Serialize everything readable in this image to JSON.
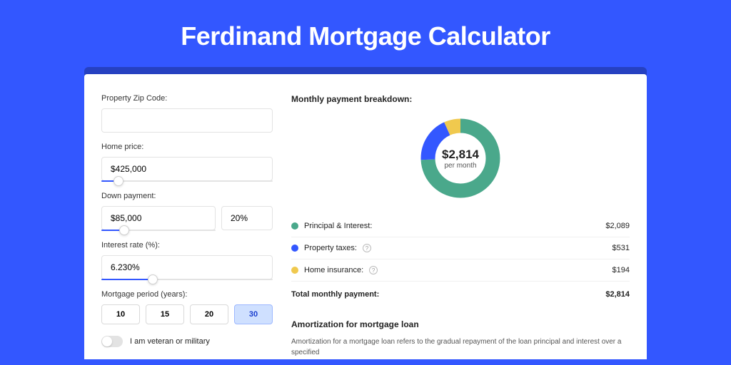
{
  "page": {
    "title": "Ferdinand Mortgage Calculator"
  },
  "form": {
    "zip": {
      "label": "Property Zip Code:",
      "value": ""
    },
    "homePrice": {
      "label": "Home price:",
      "value": "$425,000",
      "sliderPct": 10
    },
    "downPayment": {
      "label": "Down payment:",
      "amount": "$85,000",
      "percent": "20%",
      "sliderPct": 20
    },
    "interestRate": {
      "label": "Interest rate (%):",
      "value": "6.230%",
      "sliderPct": 30
    },
    "period": {
      "label": "Mortgage period (years):",
      "options": [
        "10",
        "15",
        "20",
        "30"
      ],
      "selectedIndex": 3
    },
    "veteran": {
      "label": "I am veteran or military",
      "checked": false
    }
  },
  "breakdown": {
    "title": "Monthly payment breakdown:",
    "centerAmount": "$2,814",
    "centerSub": "per month",
    "items": [
      {
        "label": "Principal & Interest:",
        "value": "$2,089",
        "color": "green",
        "help": false
      },
      {
        "label": "Property taxes:",
        "value": "$531",
        "color": "blue",
        "help": true
      },
      {
        "label": "Home insurance:",
        "value": "$194",
        "color": "yellow",
        "help": true
      }
    ],
    "totalLabel": "Total monthly payment:",
    "totalValue": "$2,814"
  },
  "amortization": {
    "title": "Amortization for mortgage loan",
    "text": "Amortization for a mortgage loan refers to the gradual repayment of the loan principal and interest over a specified"
  },
  "chart_data": {
    "type": "pie",
    "title": "Monthly payment breakdown",
    "series": [
      {
        "name": "Principal & Interest",
        "value": 2089,
        "color": "#4aa88b"
      },
      {
        "name": "Property taxes",
        "value": 531,
        "color": "#3357ff"
      },
      {
        "name": "Home insurance",
        "value": 194,
        "color": "#f0c94e"
      }
    ],
    "total": 2814,
    "unit": "USD per month"
  }
}
